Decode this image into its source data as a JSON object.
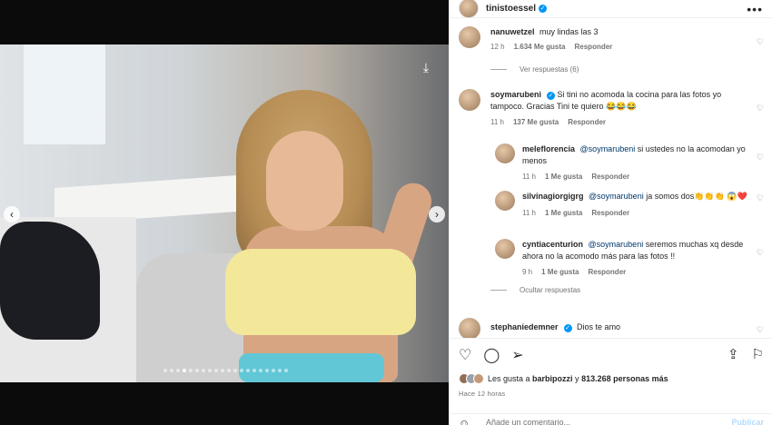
{
  "post": {
    "author": "tinistoessel",
    "verified": true,
    "more_icon": "more-horizontal-icon",
    "carousel": {
      "total_slides": 20,
      "active_slide": 4
    }
  },
  "comments": [
    {
      "id": "c1",
      "user": "nanuwetzel",
      "text": "muy lindas las 3",
      "time": "12 h",
      "likes": "1.634 Me gusta",
      "reply": "Responder",
      "view_replies": "Ver respuestas (6)"
    },
    {
      "id": "c2",
      "user": "soymarubeni",
      "verified": true,
      "text": "Si tini no acomoda la cocina para las fotos yo tampoco. Gracias Tini te quiero 😂😂😂",
      "time": "11 h",
      "likes": "137 Me gusta",
      "reply": "Responder",
      "replies": [
        {
          "user": "meleflorencia",
          "mention": "@soymarubeni",
          "text": " si ustedes no la acomodan yo menos",
          "time": "11 h",
          "likes": "1 Me gusta",
          "reply": "Responder"
        },
        {
          "user": "silvinagiorgigrg",
          "mention": "@soymarubeni",
          "text": " ja somos dos👏👏👏 😱❤️",
          "time": "11 h",
          "likes": "1 Me gusta",
          "reply": "Responder"
        },
        {
          "user": "cyntiacenturion",
          "mention": "@soymarubeni",
          "text": " seremos muchas xq desde ahora no la acomodo más para las fotos !!",
          "time": "9 h",
          "likes": "1 Me gusta",
          "reply": "Responder"
        }
      ],
      "hide_replies": "Ocultar respuestas"
    },
    {
      "id": "c3",
      "user": "stephaniedemner",
      "verified": true,
      "text": "Dios te amo"
    }
  ],
  "actions": {
    "liked_by_prefix": "Les gusta a ",
    "liked_by_user": "barbipozzi",
    "liked_by_suffix": " y ",
    "liked_count": "813.268 personas más",
    "posted_time": "Hace 12 horas",
    "comment_placeholder": "Añade un comentario...",
    "publish_label": "Publicar"
  }
}
